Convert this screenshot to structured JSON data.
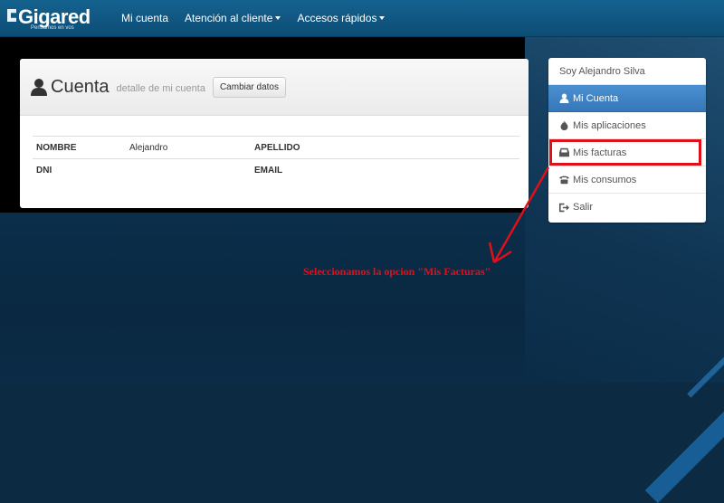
{
  "brand": {
    "name": "Gigared",
    "tagline": "Pensamos en vos"
  },
  "nav": {
    "items": [
      {
        "label": "Mi cuenta"
      },
      {
        "label": "Atención al cliente"
      },
      {
        "label": "Accesos rápidos"
      }
    ]
  },
  "panel": {
    "title": "Cuenta",
    "subtitle": "detalle de mi cuenta",
    "button_label": "Cambiar datos",
    "fields": {
      "nombre_label": "NOMBRE",
      "nombre_value": "Alejandro",
      "apellido_label": "APELLIDO",
      "apellido_value": "",
      "dni_label": "DNI",
      "dni_value": "",
      "email_label": "EMAIL",
      "email_value": ""
    }
  },
  "sidebar": {
    "user": "Soy Alejandro Silva",
    "items": [
      {
        "label": "Mi Cuenta",
        "icon": "user-icon",
        "active": true
      },
      {
        "label": "Mis aplicaciones",
        "icon": "fire-icon"
      },
      {
        "label": "Mis facturas",
        "icon": "inbox-icon"
      },
      {
        "label": "Mis consumos",
        "icon": "phone-icon"
      },
      {
        "label": "Salir",
        "icon": "logout-icon"
      }
    ]
  },
  "annotation": {
    "text": "Seleccionamos la opcion \"Mis Facturas\"",
    "color": "#e0101a"
  },
  "colors": {
    "navbar": "#0d4d75",
    "active": "#3677b8"
  }
}
